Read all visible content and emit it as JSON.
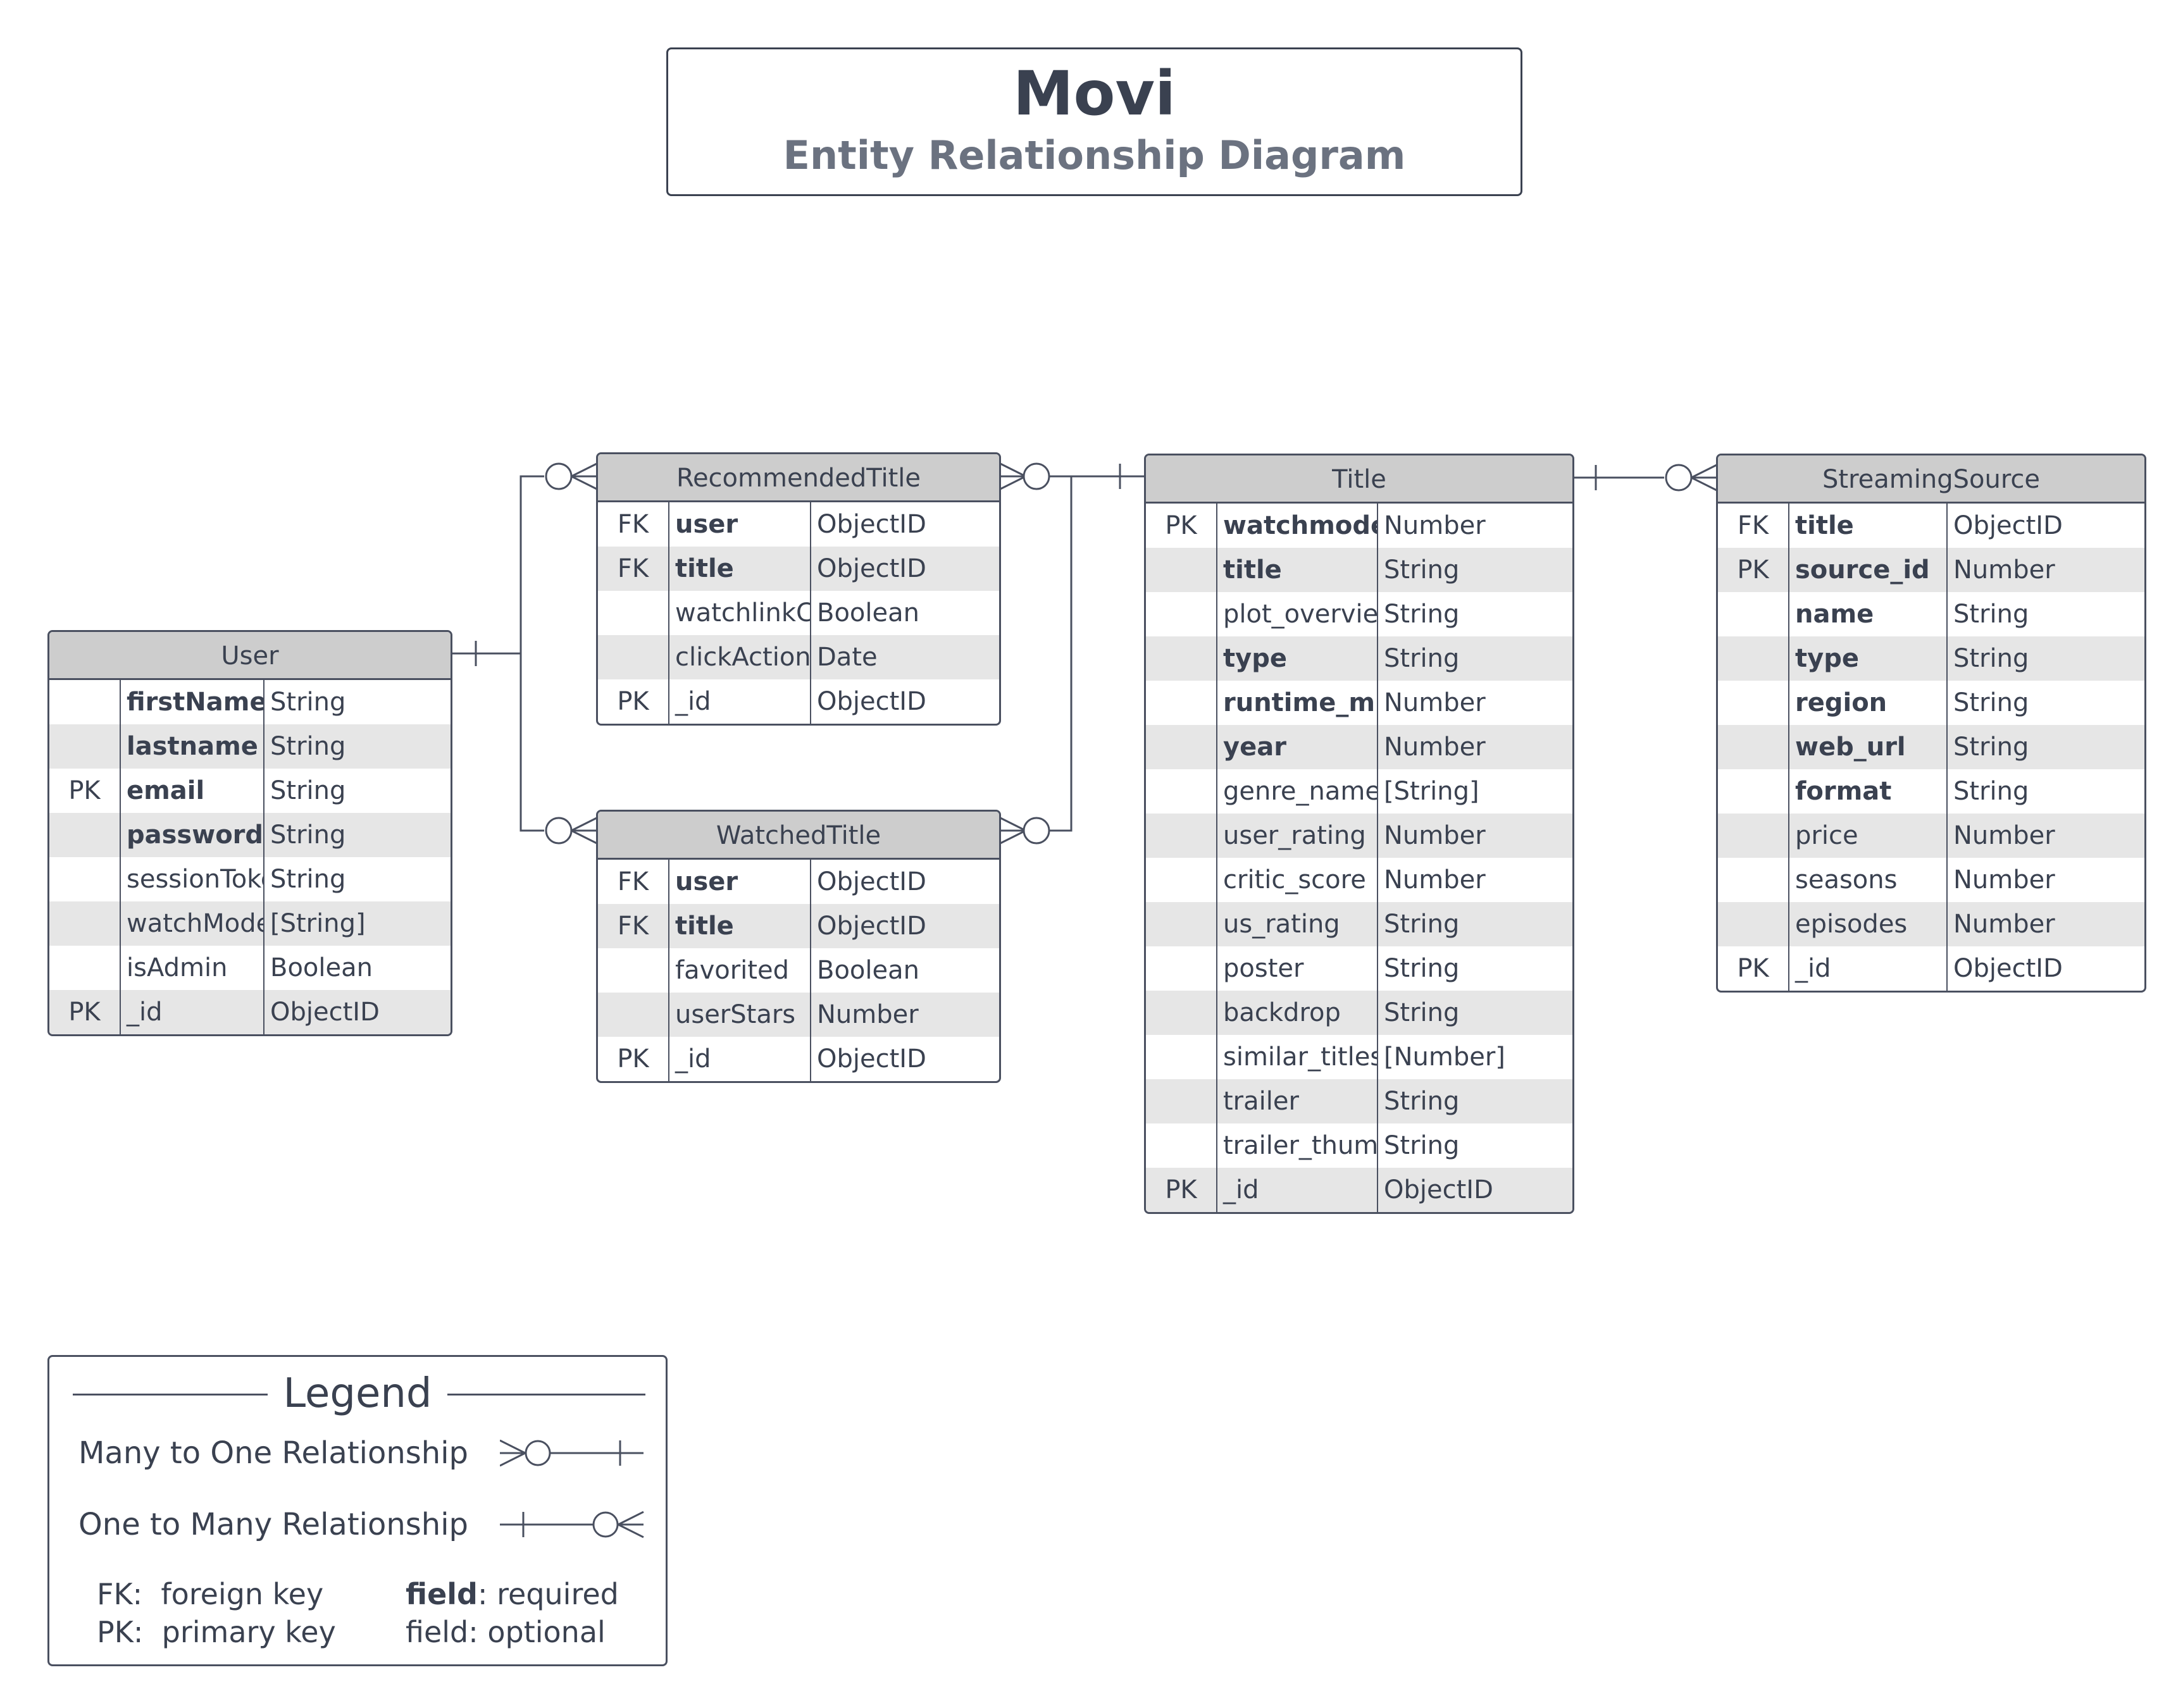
{
  "header": {
    "title": "Movi",
    "subtitle": "Entity Relationship Diagram"
  },
  "entities": {
    "user": {
      "name": "User",
      "rows": [
        {
          "key": "",
          "field": "firstName",
          "type": "String",
          "required": true
        },
        {
          "key": "",
          "field": "lastname",
          "type": "String",
          "required": true
        },
        {
          "key": "PK",
          "field": "email",
          "type": "String",
          "required": true
        },
        {
          "key": "",
          "field": "passwordHash",
          "type": "String",
          "required": true
        },
        {
          "key": "",
          "field": "sessionToken",
          "type": "String",
          "required": false
        },
        {
          "key": "",
          "field": "watchModes",
          "type": "[String]",
          "required": false
        },
        {
          "key": "",
          "field": "isAdmin",
          "type": "Boolean",
          "required": false
        },
        {
          "key": "PK",
          "field": "_id",
          "type": "ObjectID",
          "required": false
        }
      ]
    },
    "recommended": {
      "name": "RecommendedTitle",
      "rows": [
        {
          "key": "FK",
          "field": "user",
          "type": "ObjectID",
          "required": true
        },
        {
          "key": "FK",
          "field": "title",
          "type": "ObjectID",
          "required": true
        },
        {
          "key": "",
          "field": "watchlinkClicked",
          "type": "Boolean",
          "required": false
        },
        {
          "key": "",
          "field": "clickActionDate",
          "type": "Date",
          "required": false
        },
        {
          "key": "PK",
          "field": "_id",
          "type": "ObjectID",
          "required": false
        }
      ]
    },
    "watched": {
      "name": "WatchedTitle",
      "rows": [
        {
          "key": "FK",
          "field": "user",
          "type": "ObjectID",
          "required": true
        },
        {
          "key": "FK",
          "field": "title",
          "type": "ObjectID",
          "required": true
        },
        {
          "key": "",
          "field": "favorited",
          "type": "Boolean",
          "required": false
        },
        {
          "key": "",
          "field": "userStars",
          "type": "Number",
          "required": false
        },
        {
          "key": "PK",
          "field": "_id",
          "type": "ObjectID",
          "required": false
        }
      ]
    },
    "title": {
      "name": "Title",
      "rows": [
        {
          "key": "PK",
          "field": "watchmodeId",
          "type": "Number",
          "required": true
        },
        {
          "key": "",
          "field": "title",
          "type": "String",
          "required": true
        },
        {
          "key": "",
          "field": "plot_overview",
          "type": "String",
          "required": false
        },
        {
          "key": "",
          "field": "type",
          "type": "String",
          "required": true
        },
        {
          "key": "",
          "field": "runtime_minutes",
          "type": "Number",
          "required": true
        },
        {
          "key": "",
          "field": "year",
          "type": "Number",
          "required": true
        },
        {
          "key": "",
          "field": "genre_names",
          "type": "[String]",
          "required": false
        },
        {
          "key": "",
          "field": "user_rating",
          "type": "Number",
          "required": false
        },
        {
          "key": "",
          "field": "critic_score",
          "type": "Number",
          "required": false
        },
        {
          "key": "",
          "field": "us_rating",
          "type": "String",
          "required": false
        },
        {
          "key": "",
          "field": "poster",
          "type": "String",
          "required": false
        },
        {
          "key": "",
          "field": "backdrop",
          "type": "String",
          "required": false
        },
        {
          "key": "",
          "field": "similar_titles",
          "type": "[Number]",
          "required": false
        },
        {
          "key": "",
          "field": "trailer",
          "type": "String",
          "required": false
        },
        {
          "key": "",
          "field": "trailer_thumbnail",
          "type": "String",
          "required": false
        },
        {
          "key": "PK",
          "field": "_id",
          "type": "ObjectID",
          "required": false
        }
      ]
    },
    "streaming": {
      "name": "StreamingSource",
      "rows": [
        {
          "key": "FK",
          "field": "title",
          "type": "ObjectID",
          "required": true
        },
        {
          "key": "PK",
          "field": "source_id",
          "type": "Number",
          "required": true
        },
        {
          "key": "",
          "field": "name",
          "type": "String",
          "required": true
        },
        {
          "key": "",
          "field": "type",
          "type": "String",
          "required": true
        },
        {
          "key": "",
          "field": "region",
          "type": "String",
          "required": true
        },
        {
          "key": "",
          "field": "web_url",
          "type": "String",
          "required": true
        },
        {
          "key": "",
          "field": "format",
          "type": "String",
          "required": true
        },
        {
          "key": "",
          "field": "price",
          "type": "Number",
          "required": false
        },
        {
          "key": "",
          "field": "seasons",
          "type": "Number",
          "required": false
        },
        {
          "key": "",
          "field": "episodes",
          "type": "Number",
          "required": false
        },
        {
          "key": "PK",
          "field": "_id",
          "type": "ObjectID",
          "required": false
        }
      ]
    }
  },
  "legend": {
    "title": "Legend",
    "many_to_one": "Many to One Relationship",
    "one_to_many": "One to Many Relationship",
    "fk_abbr": "FK:",
    "fk_desc": "foreign key",
    "pk_abbr": "PK:",
    "pk_desc": "primary key",
    "required_field": "field",
    "required_label": ": required",
    "optional_label": "field: optional"
  }
}
